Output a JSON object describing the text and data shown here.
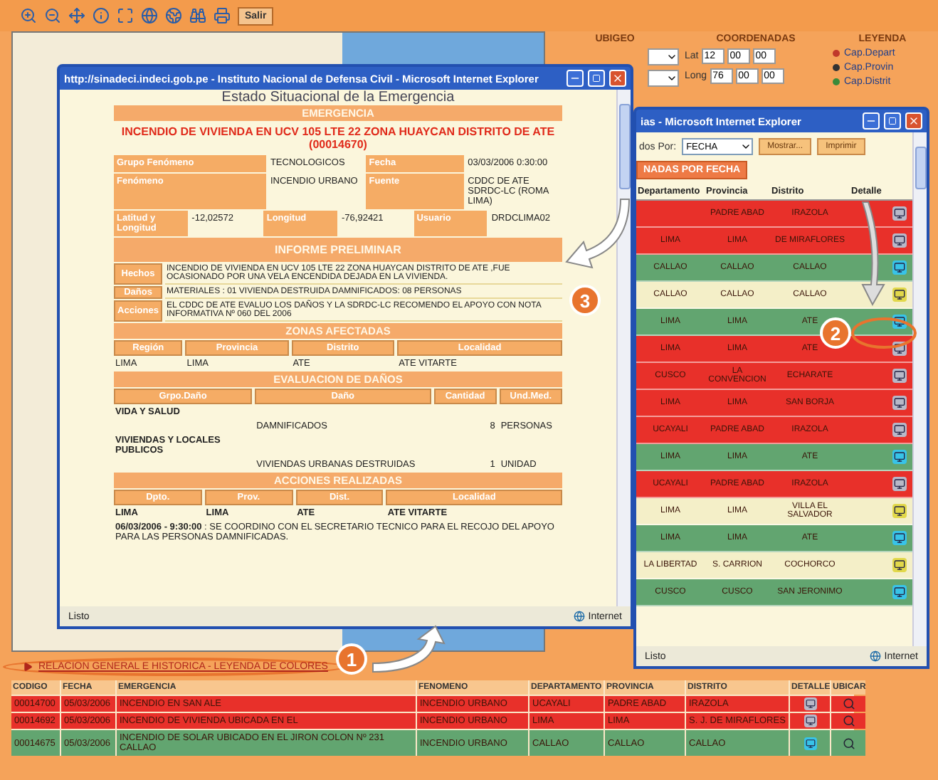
{
  "toolbar": {
    "button": "Salir"
  },
  "panel": {
    "headers": [
      "UBIGEO",
      "COORDENADAS",
      "LEYENDA"
    ],
    "lat_label": "Lat",
    "lat": [
      "12",
      "00",
      "00"
    ],
    "long_label": "Long",
    "long": [
      "76",
      "00",
      "00"
    ],
    "legend": [
      {
        "label": "Cap.Depart",
        "color": "#c0392b"
      },
      {
        "label": "Cap.Provin",
        "color": "#333333"
      },
      {
        "label": "Cap.Distrit",
        "color": "#3a8a3a"
      }
    ]
  },
  "detail_window": {
    "title": "http://sinadeci.indeci.gob.pe - Instituto Nacional de Defensa Civil - Microsoft Internet Explorer",
    "heading": "Estado Situacional de la Emergencia",
    "section": "EMERGENCIA",
    "emergency_title": "INCENDIO DE VIVIENDA EN UCV 105 LTE 22 ZONA HUAYCAN DISTRITO DE ATE (00014670)",
    "info_rows": [
      [
        {
          "kind": "label",
          "text": "Grupo Fenómeno"
        },
        {
          "kind": "value",
          "text": "TECNOLOGICOS"
        },
        {
          "kind": "label",
          "text": "Fecha"
        },
        {
          "kind": "value",
          "text": "03/03/2006 0:30:00"
        }
      ],
      [
        {
          "kind": "label",
          "text": "Fenómeno"
        },
        {
          "kind": "value",
          "text": "INCENDIO URBANO"
        },
        {
          "kind": "label",
          "text": "Fuente"
        },
        {
          "kind": "value",
          "text": "CDDC DE ATE SDRDC-LC (ROMA LIMA)"
        }
      ],
      [
        {
          "kind": "label",
          "text": "Latitud y Longitud"
        },
        {
          "kind": "value",
          "text": "-12,02572"
        },
        {
          "kind": "label",
          "text": "Longitud"
        },
        {
          "kind": "value",
          "text": "-76,92421"
        },
        {
          "kind": "label",
          "text": "Usuario"
        },
        {
          "kind": "value",
          "text": "DRDCLIMA02"
        }
      ]
    ],
    "report_heading": "INFORME PRELIMINAR",
    "report": [
      {
        "label": "Hechos",
        "text": "INCENDIO DE VIVIENDA EN UCV 105 LTE 22 ZONA HUAYCAN DISTRITO DE ATE ,FUE OCASIONADO POR UNA VELA ENCENDIDA DEJADA EN LA VIVIENDA."
      },
      {
        "label": "Daños",
        "text": "MATERIALES : 01 VIVIENDA DESTRUIDA DAMNIFICADOS: 08 PERSONAS"
      },
      {
        "label": "Acciones",
        "text": "EL CDDC DE ATE EVALUO LOS DAÑOS Y LA SDRDC-LC RECOMENDO EL APOYO CON NOTA INFORMATIVA Nº 060 DEL 2006"
      }
    ],
    "zones": {
      "heading": "ZONAS AFECTADAS",
      "columns": [
        "Región",
        "Provincia",
        "Distrito",
        "Localidad"
      ],
      "row": [
        "LIMA",
        "LIMA",
        "ATE",
        "ATE VITARTE"
      ]
    },
    "damages": {
      "heading": "EVALUACION DE DAÑOS",
      "columns": [
        "Grpo.Daño",
        "Daño",
        "Cantidad",
        "Und.Med."
      ],
      "groups": [
        {
          "group": "VIDA Y SALUD",
          "item": "DAMNIFICADOS",
          "quantity": "8",
          "unit": "PERSONAS"
        },
        {
          "group": "VIVIENDAS Y LOCALES PUBLICOS",
          "item": "VIVIENDAS URBANAS DESTRUIDAS",
          "quantity": "1",
          "unit": "UNIDAD"
        }
      ]
    },
    "actions": {
      "heading": "ACCIONES REALIZADAS",
      "columns": [
        "Dpto.",
        "Prov.",
        "Dist.",
        "Localidad"
      ],
      "row": [
        "LIMA",
        "LIMA",
        "ATE",
        "ATE VITARTE"
      ],
      "note": "**06/03/2006 - 9:30:00** : SE COORDINO CON EL SECRETARIO TECNICO PARA EL RECOJO DEL APOYO PARA LAS PERSONAS DAMNIFICADAS."
    },
    "status": "Listo",
    "zone": "Internet"
  },
  "list_window": {
    "title": "ias - Microsoft Internet Explorer",
    "order_label": "dos Por:",
    "order_value": "FECHA",
    "buttons": [
      "Mostrar...",
      "Imprimir"
    ],
    "tab": "NADAS POR FECHA",
    "columns": [
      "Departamento",
      "Provincia",
      "Distrito",
      "Detalle"
    ],
    "rows": [
      {
        "cells": [
          "",
          "PADRE ABAD",
          "IRAZOLA"
        ],
        "color": "#e8302a"
      },
      {
        "cells": [
          "LIMA",
          "LIMA",
          "DE MIRAFLORES"
        ],
        "color": "#e8302a"
      },
      {
        "cells": [
          "CALLAO",
          "CALLAO",
          "CALLAO"
        ],
        "color": "#62a570"
      },
      {
        "cells": [
          "CALLAO",
          "CALLAO",
          "CALLAO"
        ],
        "color": "#f4efc8"
      },
      {
        "cells": [
          "LIMA",
          "LIMA",
          "ATE"
        ],
        "color": "#62a570"
      },
      {
        "cells": [
          "LIMA",
          "LIMA",
          "ATE"
        ],
        "color": "#e8302a"
      },
      {
        "cells": [
          "CUSCO",
          "LA CONVENCION",
          "ECHARATE"
        ],
        "color": "#e8302a"
      },
      {
        "cells": [
          "LIMA",
          "LIMA",
          "SAN BORJA"
        ],
        "color": "#e8302a"
      },
      {
        "cells": [
          "UCAYALI",
          "PADRE ABAD",
          "IRAZOLA"
        ],
        "color": "#e8302a"
      },
      {
        "cells": [
          "LIMA",
          "LIMA",
          "ATE"
        ],
        "color": "#62a570"
      },
      {
        "cells": [
          "UCAYALI",
          "PADRE ABAD",
          "IRAZOLA"
        ],
        "color": "#e8302a"
      },
      {
        "cells": [
          "LIMA",
          "LIMA",
          "VILLA EL SALVADOR"
        ],
        "color": "#f4efc8"
      },
      {
        "cells": [
          "LIMA",
          "LIMA",
          "ATE"
        ],
        "color": "#62a570"
      },
      {
        "cells": [
          "LA LIBERTAD",
          "S. CARRION",
          "COCHORCO"
        ],
        "color": "#f4efc8"
      },
      {
        "cells": [
          "CUSCO",
          "CUSCO",
          "SAN JERONIMO"
        ],
        "color": "#62a570"
      }
    ],
    "status_left": "Listo",
    "status": "Internet"
  },
  "steps": [
    "1",
    "2",
    "3"
  ],
  "link": "RELACION GENERAL E HISTORICA - LEYENDA DE COLORES",
  "table": {
    "columns": [
      "CODIGO",
      "FECHA",
      "EMERGENCIA",
      "FENOMENO",
      "DEPARTAMENTO",
      "PROVINCIA",
      "DISTRITO",
      "DETALLE",
      "UBICAR"
    ],
    "rows": [
      {
        "cells": [
          "00014700",
          "05/03/2006",
          "INCENDIO EN SAN ALE",
          "INCENDIO URBANO",
          "UCAYALI",
          "PADRE ABAD",
          "IRAZOLA"
        ],
        "color": "#e8302a"
      },
      {
        "cells": [
          "00014692",
          "05/03/2006",
          "INCENDIO DE VIVIENDA UBICADA EN EL",
          "INCENDIO URBANO",
          "LIMA",
          "LIMA",
          "S. J. DE MIRAFLORES"
        ],
        "color": "#e8302a"
      },
      {
        "cells": [
          "00014675",
          "05/03/2006",
          "INCENDIO DE SOLAR UBICADO EN EL JIRON COLON Nº 231 CALLAO",
          "INCENDIO URBANO",
          "CALLAO",
          "CALLAO",
          "CALLAO"
        ],
        "color": "#62a570"
      }
    ]
  }
}
